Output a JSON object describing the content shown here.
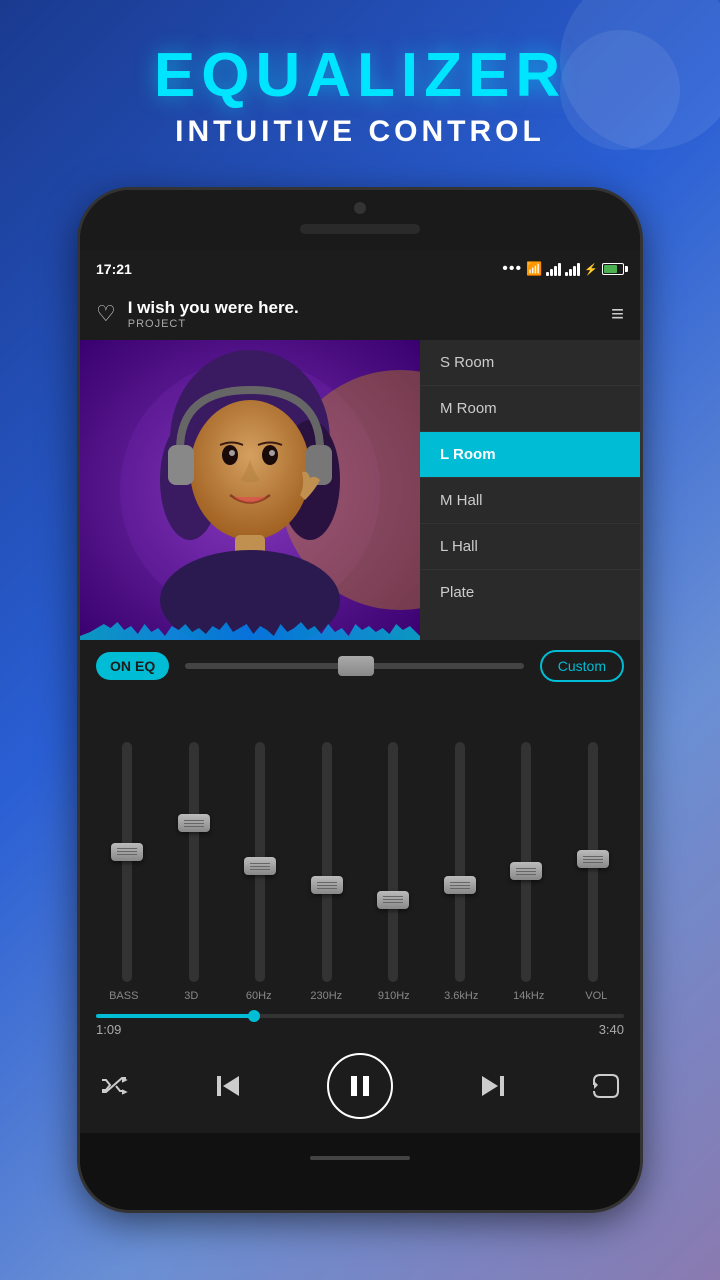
{
  "header": {
    "title": "EQUALIZER",
    "subtitle": "INTUITIVE CONTROL"
  },
  "status_bar": {
    "time": "17:21",
    "dots": "...",
    "signal1": 4,
    "signal2": 4
  },
  "song": {
    "title": "I wish you were here.",
    "project": "PROJECT"
  },
  "presets": [
    {
      "label": "S Room",
      "active": false
    },
    {
      "label": "M Room",
      "active": false
    },
    {
      "label": "L Room",
      "active": true
    },
    {
      "label": "M Hall",
      "active": false
    },
    {
      "label": "L Hall",
      "active": false
    },
    {
      "label": "Plate",
      "active": false
    }
  ],
  "eq_controls": {
    "on_label": "ON",
    "eq_label": "EQ",
    "custom_label": "Custom"
  },
  "sliders": {
    "labels": [
      "BASS",
      "3D",
      "60Hz",
      "230Hz",
      "910Hz",
      "3.6kHz",
      "14kHz",
      "VOL"
    ],
    "positions": [
      0.45,
      0.35,
      0.5,
      0.6,
      0.65,
      0.6,
      0.55,
      0.5
    ]
  },
  "progress": {
    "current": "1:09",
    "total": "3:40",
    "percent": 30
  },
  "playback": {
    "shuffle": "⇌",
    "prev": "⏮",
    "play_pause": "⏸",
    "next": "⏭",
    "repeat": "↺"
  }
}
